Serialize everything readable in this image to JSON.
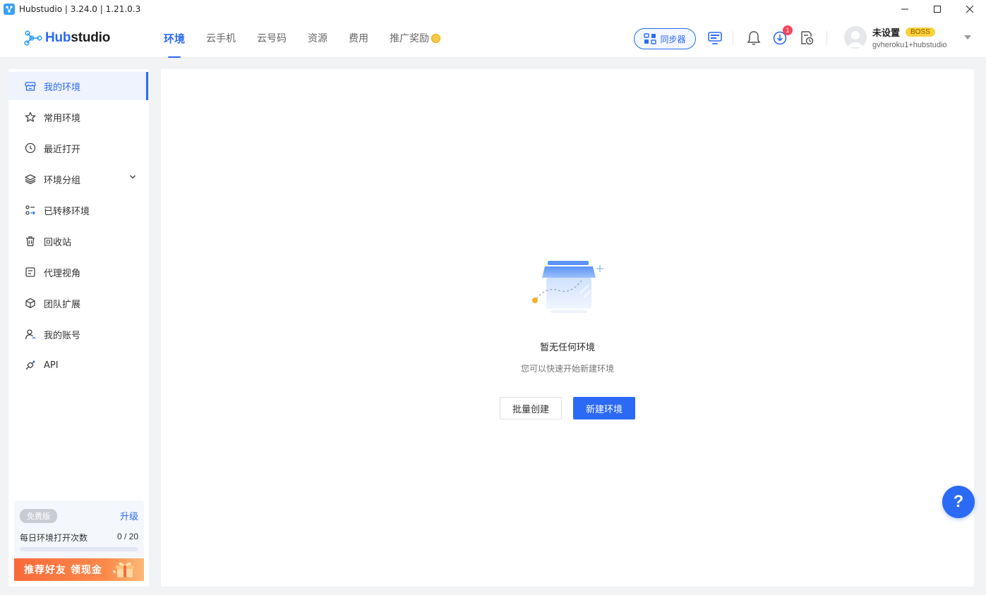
{
  "window": {
    "title": "Hubstudio | 3.24.0 | 1.21.0.3"
  },
  "header": {
    "logo_prefix": "Hub",
    "logo_suffix": "studio",
    "nav": [
      {
        "label": "环境",
        "active": true
      },
      {
        "label": "云手机"
      },
      {
        "label": "云号码"
      },
      {
        "label": "资源"
      },
      {
        "label": "费用"
      },
      {
        "label": "推广奖励"
      }
    ],
    "sync_label": "同步器",
    "download_badge": "1",
    "user": {
      "name": "未设置",
      "role_badge": "BOSS",
      "email": "gvheroku1+hubstudio"
    }
  },
  "sidebar": {
    "items": [
      {
        "label": "我的环境",
        "icon": "store-icon",
        "active": true
      },
      {
        "label": "常用环境",
        "icon": "star-icon"
      },
      {
        "label": "最近打开",
        "icon": "clock-icon"
      },
      {
        "label": "环境分组",
        "icon": "layers-icon",
        "expandable": true
      },
      {
        "label": "已转移环境",
        "icon": "transfer-icon"
      },
      {
        "label": "回收站",
        "icon": "trash-icon"
      },
      {
        "label": "代理视角",
        "icon": "proxy-icon"
      },
      {
        "label": "团队扩展",
        "icon": "cube-icon"
      },
      {
        "label": "我的账号",
        "icon": "user-icon"
      },
      {
        "label": "API",
        "icon": "plug-icon"
      }
    ],
    "plan": {
      "badge": "免费版",
      "upgrade": "升级",
      "daily_label": "每日环境打开次数",
      "daily_count": "0 / 20",
      "daily_used": 0,
      "daily_total": 20
    },
    "promo": "推荐好友 领现金"
  },
  "main": {
    "empty_title": "暂无任何环境",
    "empty_subtitle": "您可以快速开始新建环境",
    "batch_button": "批量创建",
    "new_button": "新建环境"
  },
  "help_label": "?",
  "colors": {
    "primary": "#2b6af5",
    "badge_red": "#f5455c",
    "boss_yellow": "#fbd13c"
  }
}
